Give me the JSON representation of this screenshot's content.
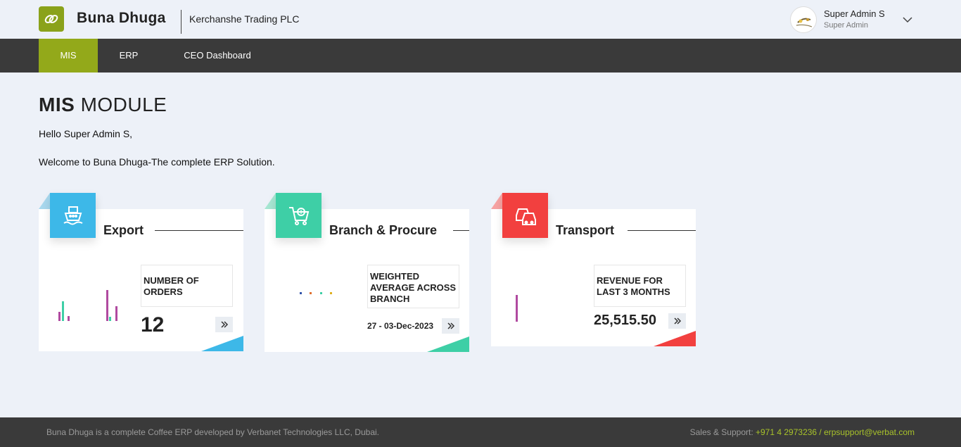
{
  "header": {
    "brand": "Buna Dhuga",
    "company": "Kerchanshe Trading PLC",
    "user_name": "Super Admin S",
    "user_role": "Super Admin",
    "accent": "#93a91a"
  },
  "nav": {
    "items": [
      {
        "label": "MIS",
        "active": true
      },
      {
        "label": "ERP",
        "active": false
      },
      {
        "label": "CEO Dashboard",
        "active": false
      }
    ]
  },
  "main": {
    "title_bold": "MIS",
    "title_rest": "MODULE",
    "greeting": "Hello Super Admin S,",
    "welcome": "Welcome to Buna Dhuga-The complete ERP Solution."
  },
  "cards": [
    {
      "title": "Export",
      "metric_label": "NUMBER OF ORDERS",
      "metric_value": "12",
      "color": "#3db8e8",
      "icon": "ship-icon"
    },
    {
      "title": "Branch & Procure",
      "metric_label": "WEIGHTED AVERAGE ACROSS BRANCH",
      "metric_value": "27 - 03-Dec-2023",
      "color": "#3ecfa6",
      "icon": "shopping-cart-icon"
    },
    {
      "title": "Transport",
      "metric_label": "REVENUE FOR LAST 3 MONTHS",
      "metric_value": "25,515.50",
      "color": "#f2403f",
      "icon": "cars-icon"
    }
  ],
  "footer": {
    "left_text": "Buna Dhuga is a complete Coffee ERP developed by Verbanet Technologies LLC, Dubai.",
    "right_prefix": "Sales & Support: ",
    "right_contact": "+971 4 2973236 / erpsupport@verbat.com"
  }
}
